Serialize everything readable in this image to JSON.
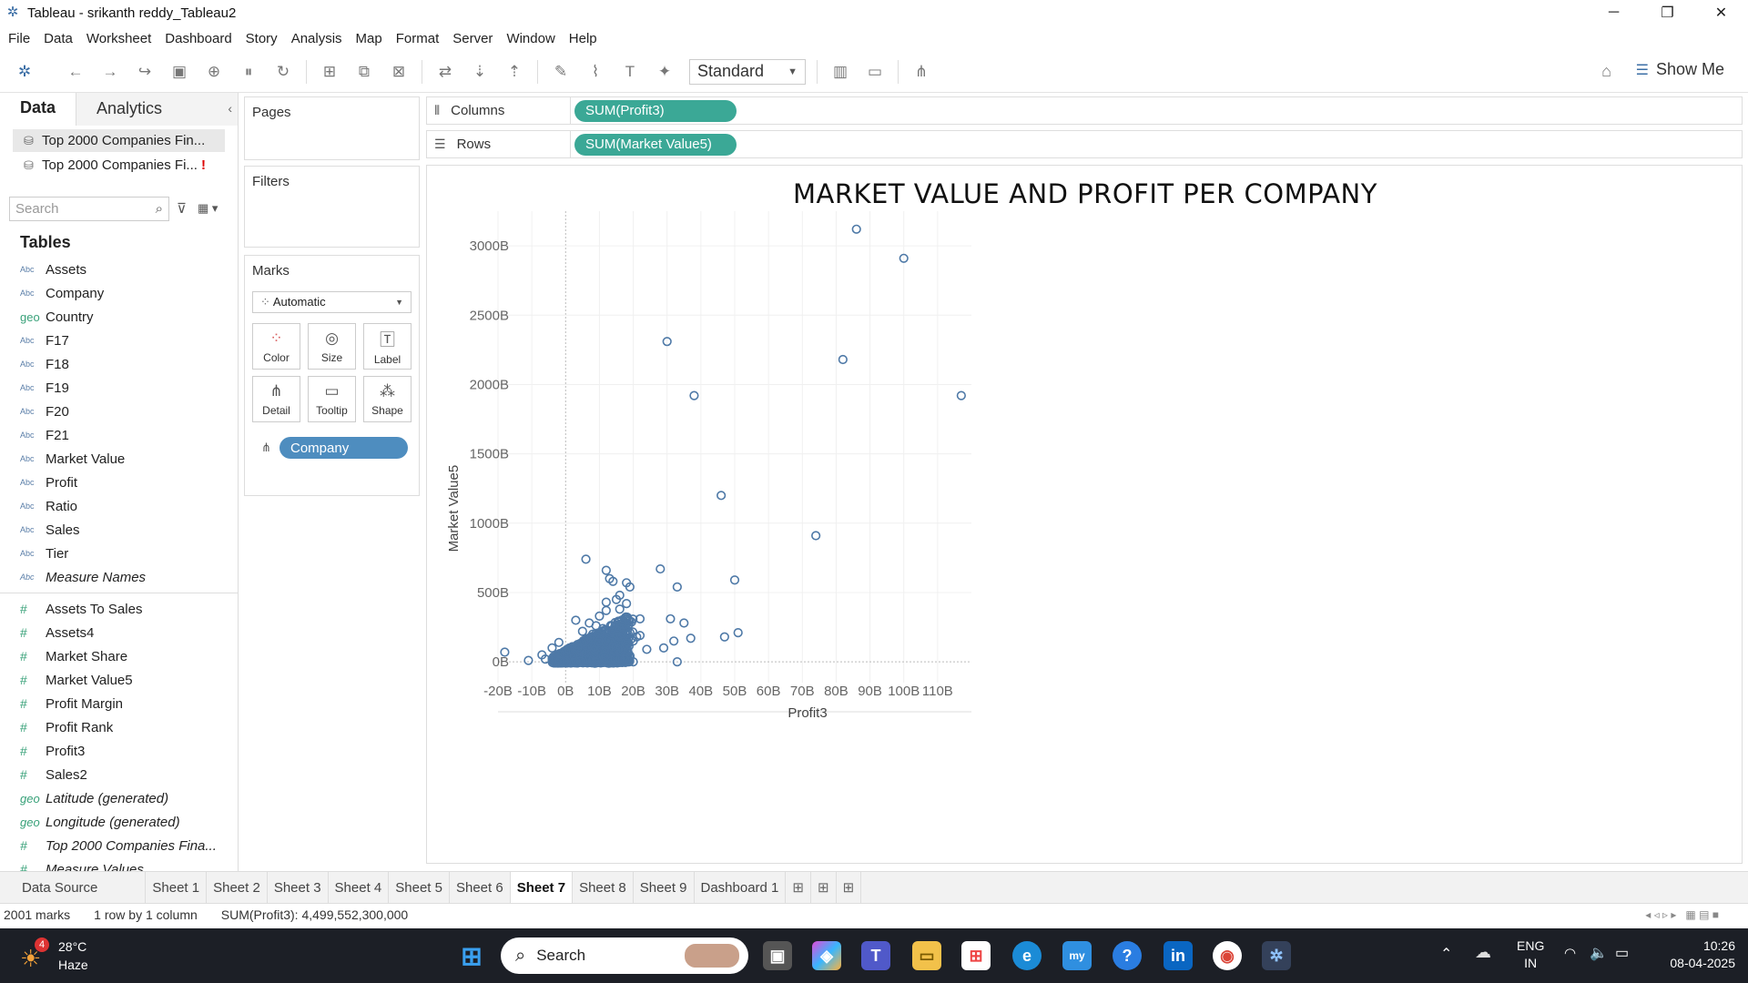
{
  "window": {
    "title": "Tableau - srikanth reddy_Tableau2",
    "minimize": "─",
    "maximize": "❐",
    "close": "✕"
  },
  "menu": [
    "File",
    "Data",
    "Worksheet",
    "Dashboard",
    "Story",
    "Analysis",
    "Map",
    "Format",
    "Server",
    "Window",
    "Help"
  ],
  "toolbar": {
    "fit_select": "Standard",
    "show_me": "Show Me"
  },
  "data_pane": {
    "tab_data": "Data",
    "tab_analytics": "Analytics",
    "datasources": [
      {
        "label": "Top 2000 Companies Fin...",
        "selected": true
      },
      {
        "label": "Top 2000 Companies Fi...",
        "warning": "!"
      }
    ],
    "search_placeholder": "Search",
    "tables_header": "Tables",
    "dimensions": [
      {
        "type": "Abc",
        "label": "Assets"
      },
      {
        "type": "Abc",
        "label": "Company"
      },
      {
        "type": "geo",
        "label": "Country"
      },
      {
        "type": "Abc",
        "label": "F17"
      },
      {
        "type": "Abc",
        "label": "F18"
      },
      {
        "type": "Abc",
        "label": "F19"
      },
      {
        "type": "Abc",
        "label": "F20"
      },
      {
        "type": "Abc",
        "label": "F21"
      },
      {
        "type": "Abc",
        "label": "Market Value"
      },
      {
        "type": "Abc",
        "label": "Profit"
      },
      {
        "type": "Abc",
        "label": "Ratio"
      },
      {
        "type": "Abc",
        "label": "Sales"
      },
      {
        "type": "Abc",
        "label": "Tier"
      },
      {
        "type": "Abc",
        "label": "Measure Names",
        "italic": true
      }
    ],
    "measures": [
      {
        "type": "#",
        "label": "Assets To Sales"
      },
      {
        "type": "#",
        "label": "Assets4"
      },
      {
        "type": "#",
        "label": "Market Share"
      },
      {
        "type": "#",
        "label": "Market Value5"
      },
      {
        "type": "#",
        "label": "Profit Margin"
      },
      {
        "type": "#",
        "label": "Profit Rank"
      },
      {
        "type": "#",
        "label": "Profit3"
      },
      {
        "type": "#",
        "label": "Sales2"
      },
      {
        "type": "geo",
        "label": "Latitude (generated)",
        "italic": true
      },
      {
        "type": "geo",
        "label": "Longitude (generated)",
        "italic": true
      },
      {
        "type": "#",
        "label": "Top 2000 Companies Fina...",
        "italic": true
      },
      {
        "type": "#",
        "label": "Measure Values",
        "italic": true
      }
    ]
  },
  "shelves": {
    "pages": "Pages",
    "filters": "Filters",
    "marks": "Marks",
    "mark_type": "Automatic",
    "mark_buttons": [
      "Color",
      "Size",
      "Label",
      "Detail",
      "Tooltip",
      "Shape"
    ],
    "detail_pill": "Company",
    "columns_label": "Columns",
    "columns_pill": "SUM(Profit3)",
    "rows_label": "Rows",
    "rows_pill": "SUM(Market Value5)"
  },
  "chart_data": {
    "type": "scatter",
    "title": "MARKET VALUE AND PROFIT PER COMPANY",
    "xlabel": "Profit3",
    "ylabel": "Market Value5",
    "xlim": [
      -20,
      120
    ],
    "ylim": [
      -150,
      3250
    ],
    "x_ticks": [
      "-20B",
      "-10B",
      "0B",
      "10B",
      "20B",
      "30B",
      "40B",
      "50B",
      "60B",
      "70B",
      "80B",
      "90B",
      "100B",
      "110B"
    ],
    "x_tick_values": [
      -20,
      -10,
      0,
      10,
      20,
      30,
      40,
      50,
      60,
      70,
      80,
      90,
      100,
      110
    ],
    "y_ticks": [
      "0B",
      "500B",
      "1000B",
      "1500B",
      "2000B",
      "2500B",
      "3000B"
    ],
    "y_tick_values": [
      0,
      500,
      1000,
      1500,
      2000,
      2500,
      3000
    ],
    "units": "billions",
    "point_color": "#4e79a7",
    "outliers": [
      [
        86,
        3120
      ],
      [
        100,
        2910
      ],
      [
        30,
        2310
      ],
      [
        82,
        2180
      ],
      [
        38,
        1920
      ],
      [
        117,
        1920
      ],
      [
        46,
        1200
      ],
      [
        74,
        910
      ],
      [
        6,
        740
      ],
      [
        28,
        670
      ],
      [
        12,
        660
      ],
      [
        13,
        600
      ],
      [
        14,
        580
      ],
      [
        50,
        590
      ],
      [
        33,
        540
      ],
      [
        18,
        570
      ],
      [
        19,
        540
      ],
      [
        -18,
        70
      ],
      [
        -11,
        10
      ],
      [
        37,
        170
      ],
      [
        47,
        180
      ],
      [
        51,
        210
      ],
      [
        33,
        0
      ],
      [
        29,
        100
      ],
      [
        35,
        280
      ],
      [
        31,
        310
      ],
      [
        22,
        310
      ],
      [
        16,
        380
      ],
      [
        18,
        420
      ],
      [
        15,
        450
      ],
      [
        12,
        370
      ],
      [
        10,
        330
      ],
      [
        7,
        280
      ],
      [
        5,
        220
      ],
      [
        21,
        180
      ],
      [
        22,
        190
      ],
      [
        20,
        150
      ],
      [
        18,
        120
      ],
      [
        24,
        90
      ],
      [
        32,
        150
      ],
      [
        14,
        110
      ],
      [
        9,
        260
      ],
      [
        11,
        240
      ],
      [
        8,
        200
      ],
      [
        15,
        230
      ],
      [
        17,
        200
      ],
      [
        19,
        210
      ],
      [
        16,
        480
      ],
      [
        12,
        430
      ],
      [
        20,
        0
      ],
      [
        -7,
        50
      ],
      [
        -6,
        20
      ],
      [
        -4,
        100
      ],
      [
        -2,
        140
      ],
      [
        3,
        300
      ]
    ],
    "cluster_count": 1946
  },
  "sheets": [
    "Data Source",
    "Sheet 1",
    "Sheet 2",
    "Sheet 3",
    "Sheet 4",
    "Sheet 5",
    "Sheet 6",
    "Sheet 7",
    "Sheet 8",
    "Sheet 9",
    "Dashboard 1"
  ],
  "active_sheet": "Sheet 7",
  "status": {
    "marks": "2001 marks",
    "rows_cols": "1 row by 1 column",
    "sum": "SUM(Profit3): 4,499,552,300,000"
  },
  "taskbar": {
    "weather_temp": "28°C",
    "weather_desc": "Haze",
    "weather_badge": "4",
    "search": "Search",
    "lang1": "ENG",
    "lang2": "IN",
    "time": "10:26",
    "date": "08-04-2025"
  }
}
